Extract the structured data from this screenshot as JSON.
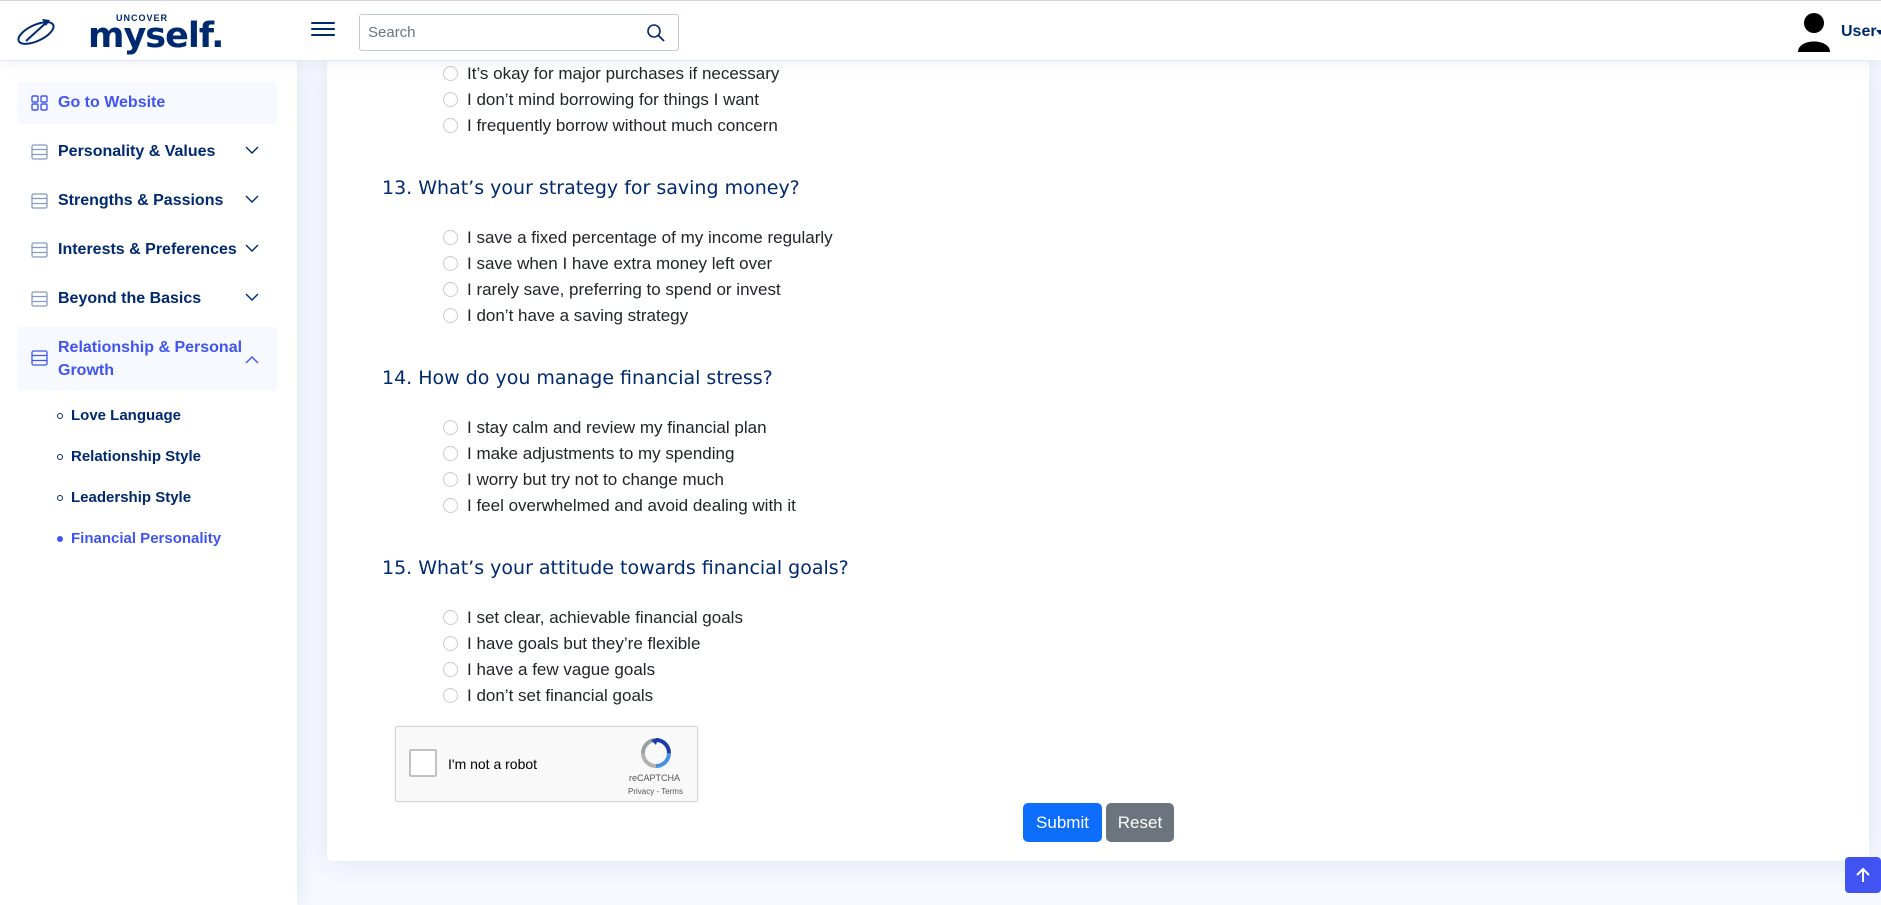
{
  "header": {
    "logo_top": "UNCOVER",
    "logo_main": "myself.",
    "search_placeholder": "Search",
    "user_label": "User"
  },
  "sidebar": {
    "items": [
      {
        "label": "Go to Website",
        "icon": "grid-icon"
      },
      {
        "label": "Personality & Values",
        "icon": "menu-icon"
      },
      {
        "label": "Strengths & Passions",
        "icon": "menu-icon"
      },
      {
        "label": "Interests & Preferences",
        "icon": "menu-icon"
      },
      {
        "label": "Beyond the Basics",
        "icon": "menu-icon"
      },
      {
        "label": "Relationship & Personal Growth",
        "icon": "menu-icon"
      }
    ],
    "sub_items": [
      {
        "label": "Love Language"
      },
      {
        "label": "Relationship Style"
      },
      {
        "label": "Leadership Style"
      },
      {
        "label": "Financial Personality"
      }
    ]
  },
  "main": {
    "prev_options": [
      "It’s okay for major purchases if necessary",
      "I don’t mind borrowing for things I want",
      "I frequently borrow without much concern"
    ],
    "questions": [
      {
        "title": "13. What’s your strategy for saving money?",
        "options": [
          "I save a fixed percentage of my income regularly",
          "I save when I have extra money left over",
          "I rarely save, preferring to spend or invest",
          "I don’t have a saving strategy"
        ]
      },
      {
        "title": "14. How do you manage financial stress?",
        "options": [
          "I stay calm and review my financial plan",
          "I make adjustments to my spending",
          "I worry but try not to change much",
          "I feel overwhelmed and avoid dealing with it"
        ]
      },
      {
        "title": "15. What’s your attitude towards financial goals?",
        "options": [
          "I set clear, achievable financial goals",
          "I have goals but they’re flexible",
          "I have a few vague goals",
          "I don’t set financial goals"
        ]
      }
    ],
    "captcha": {
      "label": "I'm not a robot",
      "brand": "reCAPTCHA",
      "links": "Privacy - Terms"
    },
    "submit_label": "Submit",
    "reset_label": "Reset"
  }
}
